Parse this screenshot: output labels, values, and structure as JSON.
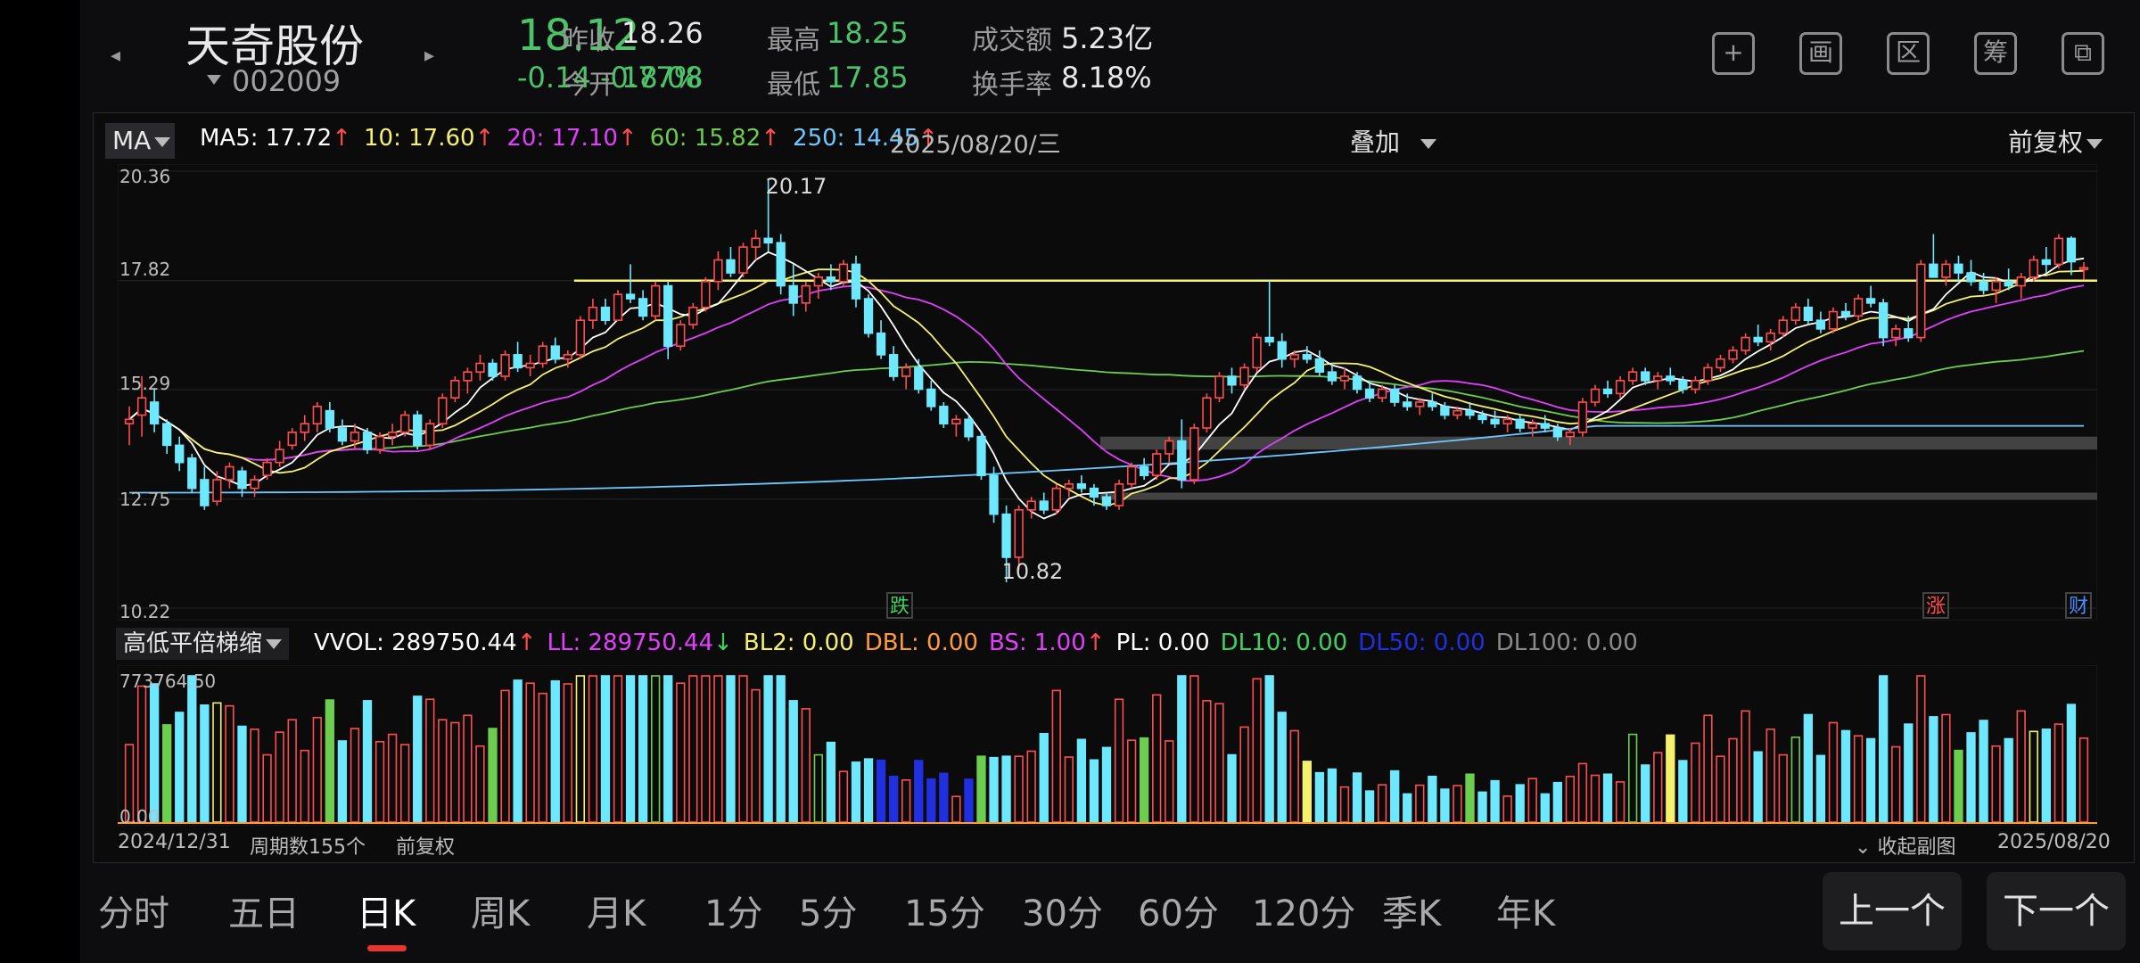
{
  "header": {
    "stock_name": "天奇股份",
    "stock_code": "002009",
    "price": "18.12",
    "change": "-0.14 -0.77%",
    "quotes": [
      {
        "label": "昨收",
        "value": "18.26",
        "color": "white"
      },
      {
        "label": "今开",
        "value": "18.08",
        "color": "green"
      },
      {
        "label": "最高",
        "value": "18.25",
        "color": "green"
      },
      {
        "label": "最低",
        "value": "17.85",
        "color": "green"
      },
      {
        "label": "成交额",
        "value": "5.23亿",
        "color": "white"
      },
      {
        "label": "换手率",
        "value": "8.18%",
        "color": "white"
      }
    ],
    "tools": [
      {
        "name": "add-icon",
        "glyph": "+"
      },
      {
        "name": "draw-icon",
        "glyph": "画"
      },
      {
        "name": "range-icon",
        "glyph": "区"
      },
      {
        "name": "chip-icon",
        "glyph": "筹"
      },
      {
        "name": "rotate-icon",
        "glyph": "⧉"
      }
    ]
  },
  "kline": {
    "indicator": "MA",
    "ma": [
      {
        "text": "MA5: 17.72",
        "color": "#ffffff"
      },
      {
        "text": "10: 17.60",
        "color": "#f5f06e"
      },
      {
        "text": "20: 17.10",
        "color": "#e040fb"
      },
      {
        "text": "60: 15.82",
        "color": "#6ccd4e"
      },
      {
        "text": "250: 14.45",
        "color": "#6ec8ff"
      }
    ],
    "date": "2025/08/20/三",
    "overlay_label": "叠加",
    "adjust_label": "前复权",
    "y_labels": [
      "20.36",
      "17.82",
      "15.29",
      "12.75",
      "10.22"
    ],
    "high_label": "20.17",
    "low_label": "10.82",
    "markers": [
      {
        "text": "跌",
        "color": "#40d060"
      },
      {
        "text": "涨",
        "color": "#ff4d4d"
      },
      {
        "text": "财",
        "color": "#4d8cff"
      }
    ]
  },
  "volume": {
    "indicator": "高低平倍梯缩",
    "legend": [
      {
        "text": "VVOL: 289750.44",
        "color": "#ffffff",
        "arrow": "↑",
        "arrow_color": "#ff4d4d"
      },
      {
        "text": "LL: 289750.44",
        "color": "#e040fb",
        "arrow": "↓",
        "arrow_color": "#40d060"
      },
      {
        "text": "BL2: 0.00",
        "color": "#f5f06e",
        "arrow": "",
        "arrow_color": ""
      },
      {
        "text": "DBL: 0.00",
        "color": "#ff9c3a",
        "arrow": "",
        "arrow_color": ""
      },
      {
        "text": "BS: 1.00",
        "color": "#e040fb",
        "arrow": "↑",
        "arrow_color": "#ff4d4d"
      },
      {
        "text": "PL: 0.00",
        "color": "#ffffff",
        "arrow": "",
        "arrow_color": ""
      },
      {
        "text": "DL10: 0.00",
        "color": "#40d060",
        "arrow": "",
        "arrow_color": ""
      },
      {
        "text": "DL50: 0.00",
        "color": "#2030e0",
        "arrow": "",
        "arrow_color": ""
      },
      {
        "text": "DL100: 0.00",
        "color": "#8a8a8a",
        "arrow": "",
        "arrow_color": ""
      }
    ],
    "max_label": "773764.50",
    "zero_label": "0.00"
  },
  "footer": {
    "start_date": "2024/12/31",
    "period_count": "周期数155个",
    "adjust": "前复权",
    "collapse": "收起副图",
    "end_date": "2025/08/20"
  },
  "period_tabs": [
    "分时",
    "五日",
    "日K",
    "周K",
    "月K",
    "1分",
    "5分",
    "15分",
    "30分",
    "60分",
    "120分",
    "季K",
    "年K"
  ],
  "active_tab": "日K",
  "nav": {
    "prev": "上一个",
    "next": "下一个"
  },
  "colors": {
    "up": "#ff4d4d",
    "down": "#40d060",
    "price_green": "#4cc36a",
    "resistance": "#f7f37a",
    "accent_red": "#e8352e"
  },
  "chart_data": {
    "type": "candlestick",
    "ylim": [
      10.22,
      20.36
    ],
    "resistance_level": 17.82,
    "support_zones": [
      [
        13.9,
        14.2
      ],
      [
        12.75,
        12.9
      ]
    ],
    "candles_ohlc": [
      [
        14.5,
        14.9,
        14.0,
        14.6
      ],
      [
        14.7,
        15.6,
        14.2,
        15.1
      ],
      [
        15.0,
        15.3,
        14.3,
        14.5
      ],
      [
        14.5,
        14.6,
        13.8,
        14.0
      ],
      [
        14.0,
        14.2,
        13.4,
        13.6
      ],
      [
        13.7,
        13.8,
        12.9,
        13.0
      ],
      [
        13.2,
        13.5,
        12.5,
        12.6
      ],
      [
        12.7,
        13.4,
        12.6,
        13.2
      ],
      [
        13.2,
        13.6,
        13.0,
        13.5
      ],
      [
        13.4,
        13.5,
        12.8,
        13.0
      ],
      [
        13.0,
        13.3,
        12.8,
        13.2
      ],
      [
        13.3,
        13.7,
        13.2,
        13.6
      ],
      [
        13.6,
        14.1,
        13.5,
        13.9
      ],
      [
        14.0,
        14.4,
        13.9,
        14.3
      ],
      [
        14.3,
        14.7,
        14.1,
        14.5
      ],
      [
        14.5,
        15.0,
        14.3,
        14.9
      ],
      [
        14.8,
        15.0,
        14.3,
        14.4
      ],
      [
        14.4,
        14.6,
        14.0,
        14.1
      ],
      [
        14.1,
        14.5,
        13.9,
        14.3
      ],
      [
        14.3,
        14.4,
        13.8,
        13.9
      ],
      [
        13.9,
        14.3,
        13.8,
        14.2
      ],
      [
        14.2,
        14.5,
        14.0,
        14.3
      ],
      [
        14.3,
        14.8,
        14.2,
        14.7
      ],
      [
        14.7,
        14.8,
        13.9,
        14.0
      ],
      [
        14.0,
        14.6,
        13.9,
        14.5
      ],
      [
        14.5,
        15.2,
        14.4,
        15.1
      ],
      [
        15.1,
        15.6,
        15.0,
        15.5
      ],
      [
        15.5,
        15.8,
        15.2,
        15.7
      ],
      [
        15.7,
        16.1,
        15.5,
        15.9
      ],
      [
        15.9,
        16.0,
        15.5,
        15.6
      ],
      [
        15.6,
        16.2,
        15.5,
        16.1
      ],
      [
        16.1,
        16.4,
        15.7,
        15.8
      ],
      [
        15.8,
        16.1,
        15.6,
        15.9
      ],
      [
        15.9,
        16.4,
        15.8,
        16.3
      ],
      [
        16.3,
        16.5,
        15.9,
        16.0
      ],
      [
        16.0,
        16.2,
        15.8,
        16.1
      ],
      [
        16.1,
        17.0,
        16.0,
        16.9
      ],
      [
        16.9,
        17.4,
        16.7,
        17.2
      ],
      [
        17.2,
        17.4,
        16.8,
        16.9
      ],
      [
        16.9,
        17.6,
        16.9,
        17.5
      ],
      [
        17.5,
        18.2,
        17.3,
        17.4
      ],
      [
        17.4,
        17.6,
        16.9,
        17.0
      ],
      [
        17.0,
        17.8,
        16.9,
        17.7
      ],
      [
        17.7,
        17.8,
        16.0,
        16.3
      ],
      [
        16.3,
        16.9,
        16.2,
        16.8
      ],
      [
        16.8,
        17.3,
        16.7,
        17.2
      ],
      [
        17.2,
        17.9,
        17.1,
        17.8
      ],
      [
        17.8,
        18.5,
        17.6,
        18.3
      ],
      [
        18.3,
        18.6,
        17.9,
        18.0
      ],
      [
        18.0,
        18.7,
        17.9,
        18.6
      ],
      [
        18.6,
        19.0,
        18.3,
        18.8
      ],
      [
        18.8,
        20.17,
        18.5,
        18.7
      ],
      [
        18.7,
        18.9,
        17.5,
        17.7
      ],
      [
        17.7,
        18.2,
        17.0,
        17.3
      ],
      [
        17.3,
        17.8,
        17.1,
        17.7
      ],
      [
        17.7,
        18.0,
        17.4,
        17.9
      ],
      [
        17.9,
        18.2,
        17.6,
        17.8
      ],
      [
        17.8,
        18.3,
        17.7,
        18.2
      ],
      [
        18.2,
        18.4,
        17.2,
        17.4
      ],
      [
        17.4,
        17.5,
        16.5,
        16.6
      ],
      [
        16.6,
        16.9,
        16.0,
        16.1
      ],
      [
        16.1,
        16.3,
        15.5,
        15.6
      ],
      [
        15.6,
        15.9,
        15.3,
        15.8
      ],
      [
        15.8,
        16.0,
        15.2,
        15.3
      ],
      [
        15.3,
        15.5,
        14.8,
        14.9
      ],
      [
        14.9,
        15.0,
        14.4,
        14.5
      ],
      [
        14.5,
        14.7,
        14.2,
        14.6
      ],
      [
        14.6,
        14.7,
        14.1,
        14.2
      ],
      [
        14.2,
        14.3,
        13.2,
        13.3
      ],
      [
        13.3,
        13.5,
        12.2,
        12.4
      ],
      [
        12.4,
        12.6,
        10.82,
        11.4
      ],
      [
        11.4,
        12.6,
        11.1,
        12.5
      ],
      [
        12.5,
        12.8,
        12.3,
        12.7
      ],
      [
        12.7,
        12.9,
        12.4,
        12.5
      ],
      [
        12.5,
        13.1,
        12.4,
        13.0
      ],
      [
        13.0,
        13.2,
        12.8,
        13.1
      ],
      [
        13.1,
        13.3,
        12.9,
        13.0
      ],
      [
        13.0,
        13.1,
        12.6,
        12.8
      ],
      [
        12.8,
        12.9,
        12.5,
        12.6
      ],
      [
        12.6,
        13.2,
        12.5,
        13.1
      ],
      [
        13.1,
        13.6,
        13.0,
        13.5
      ],
      [
        13.5,
        13.7,
        13.2,
        13.3
      ],
      [
        13.3,
        13.9,
        13.2,
        13.8
      ],
      [
        13.8,
        14.2,
        13.6,
        14.1
      ],
      [
        14.1,
        14.6,
        13.0,
        13.2
      ],
      [
        13.2,
        14.5,
        13.1,
        14.4
      ],
      [
        14.4,
        15.2,
        14.3,
        15.1
      ],
      [
        15.1,
        15.7,
        15.0,
        15.6
      ],
      [
        15.6,
        15.8,
        15.2,
        15.4
      ],
      [
        15.4,
        15.9,
        15.3,
        15.8
      ],
      [
        15.8,
        16.6,
        15.7,
        16.5
      ],
      [
        16.5,
        17.82,
        16.3,
        16.4
      ],
      [
        16.4,
        16.6,
        15.8,
        16.0
      ],
      [
        16.0,
        16.2,
        15.8,
        16.1
      ],
      [
        16.1,
        16.3,
        15.9,
        16.0
      ],
      [
        16.0,
        16.2,
        15.6,
        15.7
      ],
      [
        15.7,
        15.9,
        15.4,
        15.5
      ],
      [
        15.5,
        15.8,
        15.3,
        15.6
      ],
      [
        15.6,
        15.7,
        15.2,
        15.3
      ],
      [
        15.3,
        15.5,
        15.0,
        15.1
      ],
      [
        15.1,
        15.4,
        15.0,
        15.3
      ],
      [
        15.3,
        15.4,
        14.9,
        15.0
      ],
      [
        15.0,
        15.2,
        14.8,
        14.9
      ],
      [
        14.9,
        15.1,
        14.7,
        15.0
      ],
      [
        15.0,
        15.2,
        14.8,
        14.9
      ],
      [
        14.9,
        15.0,
        14.6,
        14.7
      ],
      [
        14.7,
        14.9,
        14.6,
        14.8
      ],
      [
        14.8,
        15.0,
        14.6,
        14.7
      ],
      [
        14.7,
        14.8,
        14.5,
        14.6
      ],
      [
        14.6,
        14.8,
        14.4,
        14.5
      ],
      [
        14.5,
        14.7,
        14.3,
        14.6
      ],
      [
        14.6,
        14.7,
        14.3,
        14.4
      ],
      [
        14.4,
        14.6,
        14.2,
        14.5
      ],
      [
        14.5,
        14.7,
        14.3,
        14.4
      ],
      [
        14.4,
        14.5,
        14.1,
        14.2
      ],
      [
        14.2,
        14.4,
        14.0,
        14.3
      ],
      [
        14.3,
        15.1,
        14.2,
        15.0
      ],
      [
        15.0,
        15.4,
        14.9,
        15.3
      ],
      [
        15.3,
        15.5,
        15.1,
        15.2
      ],
      [
        15.2,
        15.6,
        15.1,
        15.5
      ],
      [
        15.5,
        15.8,
        15.4,
        15.7
      ],
      [
        15.7,
        15.8,
        15.4,
        15.5
      ],
      [
        15.5,
        15.7,
        15.3,
        15.6
      ],
      [
        15.6,
        15.8,
        15.4,
        15.5
      ],
      [
        15.5,
        15.6,
        15.2,
        15.3
      ],
      [
        15.3,
        15.6,
        15.2,
        15.5
      ],
      [
        15.5,
        15.9,
        15.4,
        15.8
      ],
      [
        15.8,
        16.1,
        15.7,
        16.0
      ],
      [
        16.0,
        16.3,
        15.9,
        16.2
      ],
      [
        16.2,
        16.6,
        16.1,
        16.5
      ],
      [
        16.5,
        16.8,
        16.3,
        16.4
      ],
      [
        16.4,
        16.7,
        16.2,
        16.6
      ],
      [
        16.6,
        17.0,
        16.5,
        16.9
      ],
      [
        16.9,
        17.3,
        16.8,
        17.2
      ],
      [
        17.2,
        17.4,
        16.8,
        16.9
      ],
      [
        16.9,
        17.1,
        16.6,
        16.7
      ],
      [
        16.7,
        17.2,
        16.6,
        17.1
      ],
      [
        17.1,
        17.3,
        16.9,
        17.0
      ],
      [
        17.0,
        17.5,
        16.9,
        17.4
      ],
      [
        17.4,
        17.7,
        17.2,
        17.3
      ],
      [
        17.3,
        17.4,
        16.3,
        16.5
      ],
      [
        16.5,
        16.8,
        16.3,
        16.7
      ],
      [
        16.7,
        17.0,
        16.4,
        16.5
      ],
      [
        16.5,
        18.3,
        16.4,
        18.2
      ],
      [
        18.2,
        18.9,
        18.0,
        17.9
      ],
      [
        17.9,
        18.3,
        17.7,
        18.2
      ],
      [
        18.2,
        18.4,
        17.8,
        18.0
      ],
      [
        18.0,
        18.3,
        17.7,
        17.8
      ],
      [
        17.8,
        18.0,
        17.5,
        17.6
      ],
      [
        17.6,
        17.9,
        17.3,
        17.8
      ],
      [
        17.8,
        18.1,
        17.6,
        17.7
      ],
      [
        17.7,
        18.0,
        17.4,
        17.9
      ],
      [
        17.9,
        18.4,
        17.8,
        18.3
      ],
      [
        18.3,
        18.6,
        18.0,
        18.2
      ],
      [
        18.2,
        18.9,
        18.1,
        18.8
      ],
      [
        18.8,
        18.85,
        17.95,
        18.26
      ],
      [
        18.08,
        18.25,
        17.85,
        18.12
      ]
    ]
  }
}
